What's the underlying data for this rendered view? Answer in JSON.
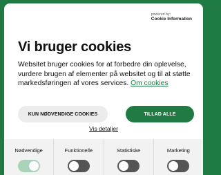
{
  "brand": {
    "powered_by": "powered by:",
    "name": "Cookie Information"
  },
  "title": "Vi bruger cookies",
  "description": "Websitet bruger cookies for at forbedre din oplevelse, vurdere brugen af elementer på websitet og til at støtte markedsføringen af vores services.",
  "about_link": "Om cookies",
  "buttons": {
    "necessary_only": "KUN NØDVENDIGE COOKIES",
    "allow_all": "TILLAD ALLE"
  },
  "details_link": "Vis detaljer",
  "categories": [
    {
      "label": "Nødvendige",
      "state": "on"
    },
    {
      "label": "Funktionelle",
      "state": "off"
    },
    {
      "label": "Statistiske",
      "state": "off"
    },
    {
      "label": "Marketing",
      "state": "off"
    }
  ],
  "colors": {
    "accent": "#1f7a44",
    "toggle_off": "#555555",
    "toggle_on_disabled": "#a9d2bb"
  }
}
